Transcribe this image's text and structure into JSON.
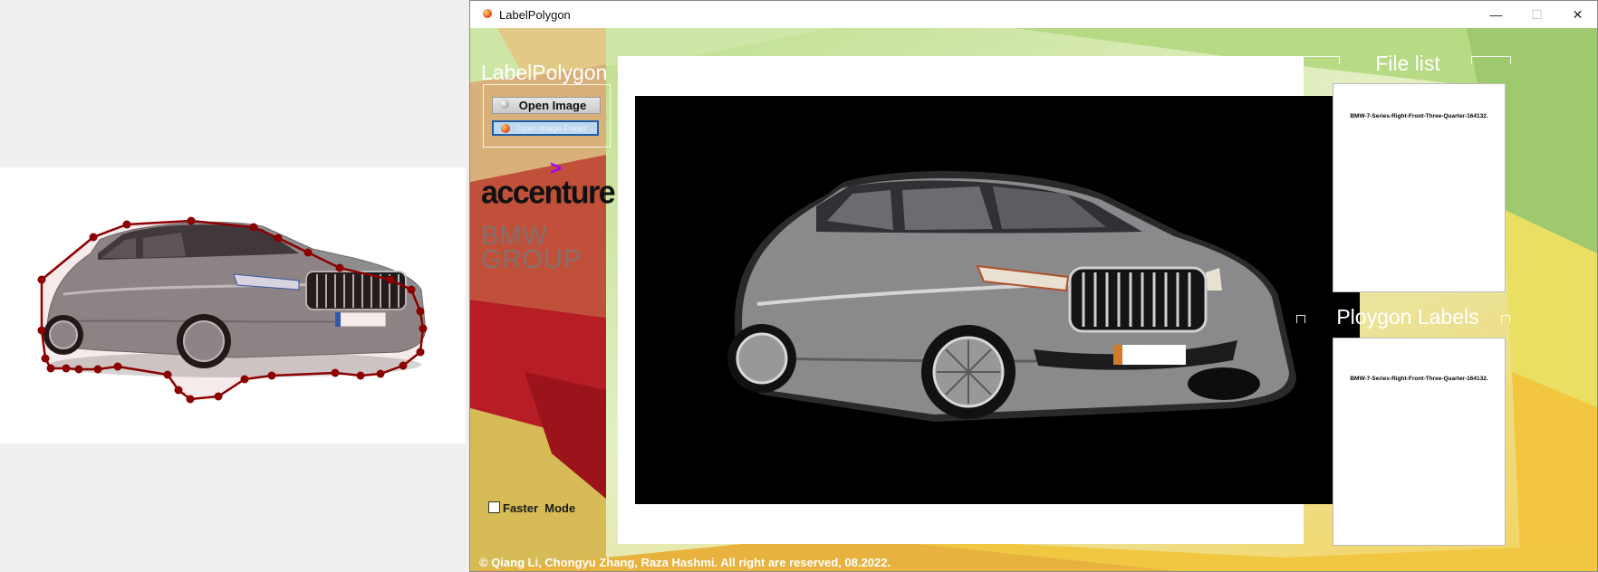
{
  "window": {
    "title": "LabelPolygon",
    "controls": {
      "minimize": "—",
      "maximize": "☐",
      "close": "✕"
    }
  },
  "sidebar": {
    "brand_title": "LabelPolygon",
    "open_image_label": "Open Image",
    "open_folder_label": "Open Image Folder",
    "accenture_logo_text": "accenture",
    "bmw_logo_text": "BMW GROUP",
    "faster_mode_label": "Faster  Mode",
    "faster_mode_checked": false
  },
  "file_list": {
    "title": "File list",
    "items": [
      "BMW-7-Series-Right-Front-Three-Quarter-164132."
    ]
  },
  "polygon_labels": {
    "title": "Ploygon Labels",
    "items": [
      "BMW-7-Series-Right-Front-Three-Quarter-164132."
    ]
  },
  "footer": {
    "copyright": "© Qiang Li, Chongyu Zhang, Raza Hashmi. All right are reserved, 08.2022."
  },
  "colors": {
    "polygon": "#8b0000",
    "car_body": "#8e8e90",
    "accent_purple": "#a100ff"
  }
}
